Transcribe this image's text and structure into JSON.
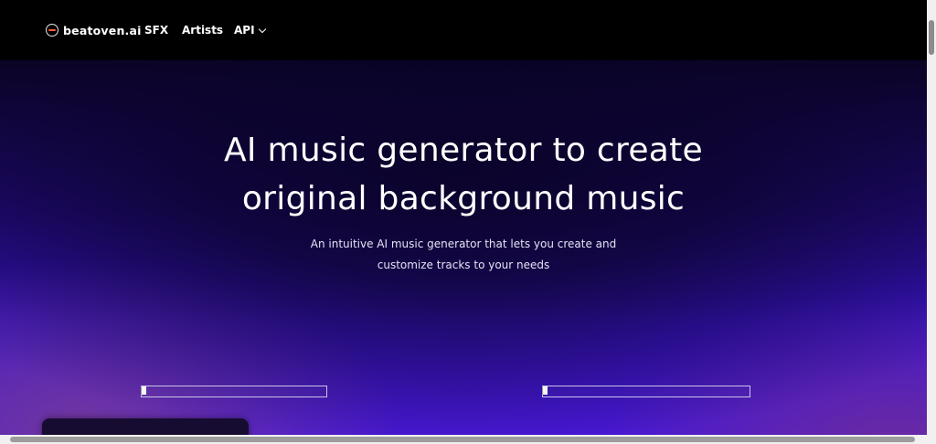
{
  "nav": {
    "logo_text": "beatoven.ai",
    "logo_icon": "beatoven-logo-icon",
    "links": {
      "sfx": "SFX",
      "artists": "Artists",
      "api": "API"
    },
    "api_dropdown_icon": "chevron-down-icon"
  },
  "hero": {
    "title_line1": "AI music generator to create",
    "title_line2": "original background music",
    "subtitle_line1": "An intuitive AI music generator that lets you create and",
    "subtitle_line2": "customize tracks to your needs"
  },
  "colors": {
    "nav_bg": "#000000",
    "hero_top": "#0b0424",
    "hero_bottom": "#4818d4",
    "text": "#ffffff"
  }
}
